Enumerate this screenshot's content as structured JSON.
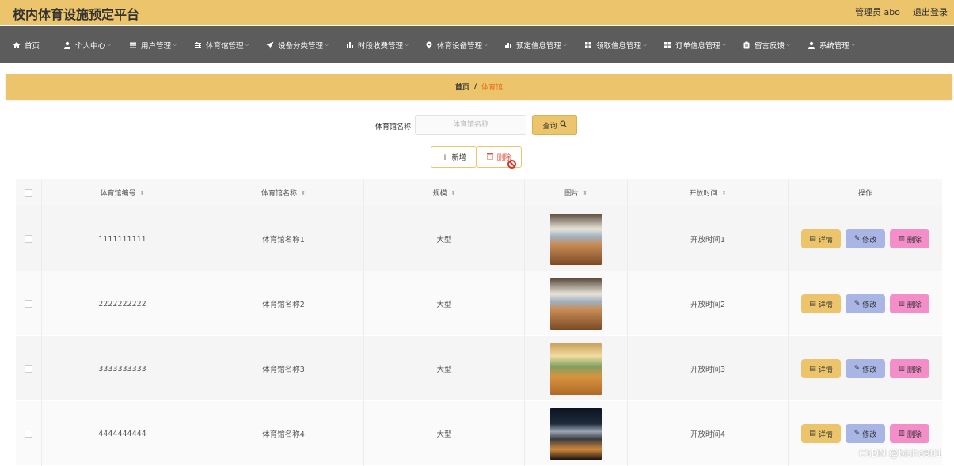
{
  "header": {
    "title": "校内体育设施预定平台",
    "user": "管理员 abo",
    "logout": "退出登录"
  },
  "nav": [
    {
      "label": "首页",
      "icon": "home-icon"
    },
    {
      "label": "个人中心",
      "icon": "user-icon"
    },
    {
      "label": "用户管理",
      "icon": "menu-icon"
    },
    {
      "label": "体育馆管理",
      "icon": "sliders-icon"
    },
    {
      "label": "设备分类管理",
      "icon": "send-icon"
    },
    {
      "label": "时段收费管理",
      "icon": "chart-icon"
    },
    {
      "label": "体育设备管理",
      "icon": "location-icon"
    },
    {
      "label": "预定信息管理",
      "icon": "bar-chart-icon"
    },
    {
      "label": "领取信息管理",
      "icon": "grid-icon"
    },
    {
      "label": "订单信息管理",
      "icon": "grid-icon"
    },
    {
      "label": "留言反馈",
      "icon": "clipboard-icon"
    },
    {
      "label": "系统管理",
      "icon": "user-icon"
    }
  ],
  "breadcrumb": {
    "home": "首页",
    "sep": "/",
    "current": "体育馆"
  },
  "search": {
    "label": "体育馆名称",
    "placeholder": "体育馆名称",
    "button": "查询"
  },
  "actions": {
    "add": "新增",
    "delete": "删除"
  },
  "table": {
    "columns": [
      "体育馆编号",
      "体育馆名称",
      "规模",
      "图片",
      "开放时间",
      "操作"
    ],
    "rows": [
      {
        "id": "1111111111",
        "name": "体育馆名称1",
        "scale": "大型",
        "open": "开放时间1"
      },
      {
        "id": "2222222222",
        "name": "体育馆名称2",
        "scale": "大型",
        "open": "开放时间2"
      },
      {
        "id": "3333333333",
        "name": "体育馆名称3",
        "scale": "大型",
        "open": "开放时间3"
      },
      {
        "id": "4444444444",
        "name": "体育馆名称4",
        "scale": "大型",
        "open": "开放时间4"
      }
    ],
    "ops": {
      "detail": "详情",
      "edit": "修改",
      "delete": "删除"
    }
  },
  "watermark": "CSDN @bishe901",
  "colors": {
    "accent": "#ecc46b",
    "nav_bg": "#5c5c5c",
    "edit": "#a9b6e5",
    "delete": "#f48ec8",
    "crumb_current": "#e56e1f"
  }
}
